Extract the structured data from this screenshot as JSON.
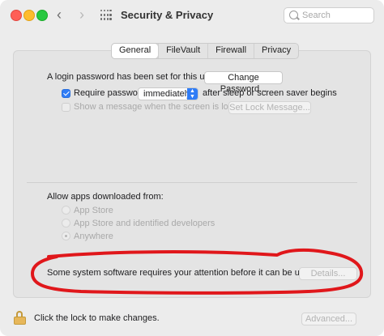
{
  "window": {
    "title": "Security & Privacy"
  },
  "toolbar": {
    "back_icon": "chevron-left-icon",
    "forward_icon": "chevron-right-icon",
    "grid_icon": "grid-icon"
  },
  "search": {
    "placeholder": "Search"
  },
  "tabs": [
    {
      "label": "General",
      "active": true
    },
    {
      "label": "FileVault",
      "active": false
    },
    {
      "label": "Firewall",
      "active": false
    },
    {
      "label": "Privacy",
      "active": false
    }
  ],
  "general": {
    "login_text": "A login password has been set for this user",
    "change_password_label": "Change Password...",
    "require_password_label": "Require password",
    "require_password_checked": true,
    "delay_value": "immediately",
    "after_sleep_text": "after sleep or screen saver begins",
    "show_message_label": "Show a message when the screen is locked",
    "show_message_checked": false,
    "set_lock_message_label": "Set Lock Message...",
    "allow_apps_label": "Allow apps downloaded from:",
    "app_sources": [
      {
        "label": "App Store",
        "selected": false
      },
      {
        "label": "App Store and identified developers",
        "selected": false
      },
      {
        "label": "Anywhere",
        "selected": true
      }
    ],
    "attention_text": "Some system software requires your attention before it can be used.",
    "details_label": "Details..."
  },
  "footer": {
    "lock_text": "Click the lock to make changes.",
    "advanced_label": "Advanced..."
  },
  "colors": {
    "accent": "#2f7cf6",
    "annotation": "#e0171b"
  }
}
